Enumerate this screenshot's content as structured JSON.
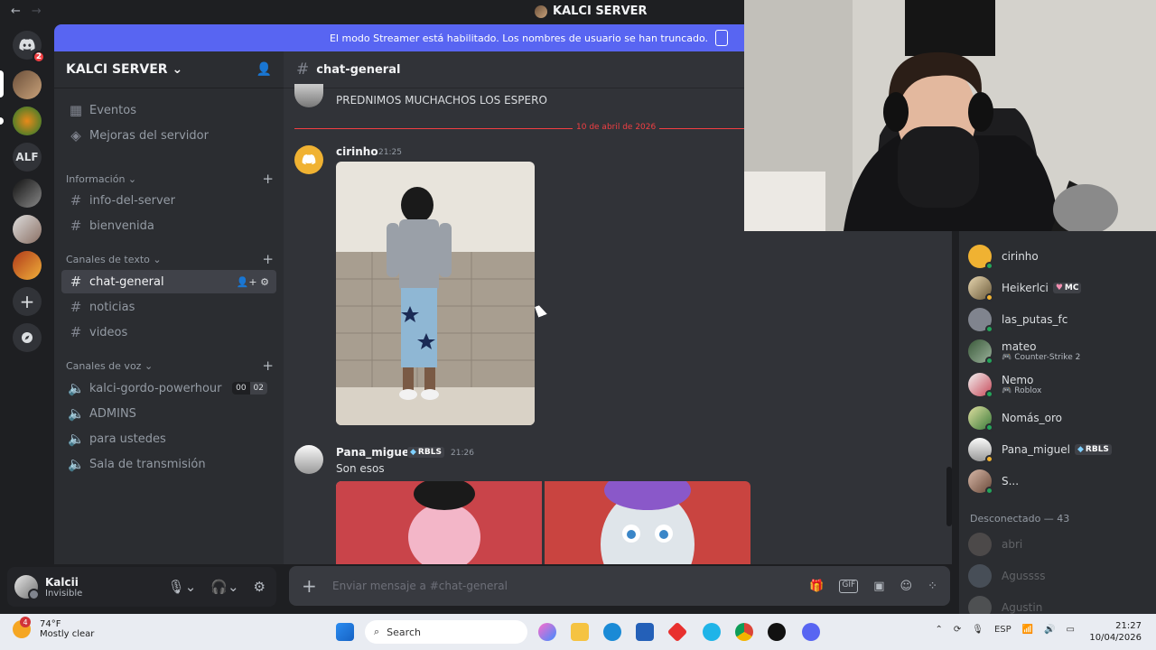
{
  "titlebar": {
    "back": "←",
    "forward": "→",
    "title": "KALCI SERVER"
  },
  "streamer_banner": "El modo Streamer está habilitado. Los nombres de usuario se han truncado.",
  "guilds": {
    "dm_badge": "2",
    "alf_label": "ALF"
  },
  "server": {
    "name": "KALCI SERVER"
  },
  "sidebar": {
    "top_items": [
      {
        "label": "Eventos",
        "icon": "calendar-icon"
      },
      {
        "label": "Mejoras del servidor",
        "icon": "boost-icon"
      }
    ],
    "categories": {
      "info": "Información",
      "text": "Canales de texto",
      "voice": "Canales de voz"
    },
    "info_channels": [
      "info-del-server",
      "bienvenida"
    ],
    "text_channels": [
      "chat-general",
      "noticias",
      "videos"
    ],
    "voice_channels": [
      "kalci-gordo-powerhour",
      "ADMINS",
      "para ustedes",
      "Sala de transmisión"
    ],
    "voice_count": [
      "00",
      "02"
    ]
  },
  "user": {
    "name": "Kalcii",
    "status": "Invisible"
  },
  "chat": {
    "channel": "chat-general",
    "prev_message": "PREDNIMOS MUCHACHOS LOS ESPERO",
    "date_divider": "10 de abril de 2026",
    "messages": [
      {
        "author": "cirinho",
        "time": "21:25",
        "text": ""
      },
      {
        "author": "Pana_miguel",
        "tag": "RBLS",
        "time": "21:26",
        "text": "Son esos"
      }
    ],
    "composer_placeholder": "Enviar mensaje a #chat-general"
  },
  "members": {
    "online": [
      {
        "name": "cirinho",
        "activity": "",
        "status_color": "#f0b232"
      },
      {
        "name": "Heikerlci",
        "tag": "MC",
        "activity": "",
        "status_color": "#f0b232"
      },
      {
        "name": "las_putas_fc",
        "activity": "",
        "status_color": "#23a55a"
      },
      {
        "name": "mateo",
        "activity": "Counter-Strike 2",
        "status_color": "#23a55a"
      },
      {
        "name": "Nemo",
        "activity": "Roblox",
        "status_color": "#23a55a"
      },
      {
        "name": "Nomás_oro",
        "activity": "",
        "status_color": "#23a55a"
      },
      {
        "name": "Pana_miguel",
        "tag": "RBLS",
        "activity": "",
        "status_color": "#f0b232"
      },
      {
        "name": "S...",
        "activity": "",
        "status_color": "#23a55a"
      }
    ],
    "offline_header": "Desconectado — 43",
    "offline": [
      "abri",
      "Agussss",
      "Agustin"
    ]
  },
  "taskbar": {
    "weather_temp": "74°F",
    "weather_desc": "Mostly clear",
    "weather_badge": "4",
    "search": "Search",
    "lang": "ESP",
    "time": "21:27",
    "date": "10/04/2026"
  },
  "colors": {
    "blurple": "#5865f2",
    "online": "#23a55a",
    "idle": "#f0b232",
    "dnd": "#f23f43"
  }
}
